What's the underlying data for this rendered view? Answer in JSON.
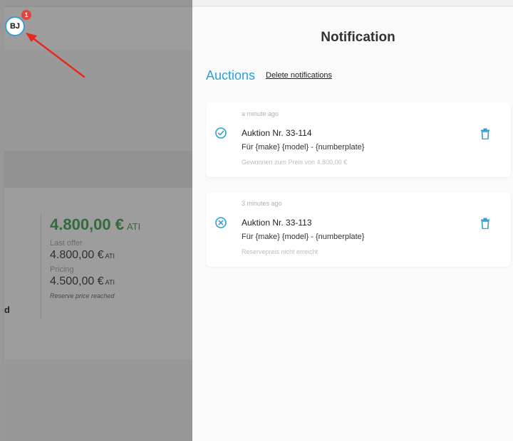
{
  "header": {
    "avatar_initials": "BJ",
    "notification_count": "1"
  },
  "background": {
    "main_price": "4.800,00 €",
    "main_price_tax": "ATI",
    "last_offer_label": "Last offer",
    "last_offer_price": "4.800,00 €",
    "last_offer_tax": "ATI",
    "pricing_label": "Pricing",
    "pricing_price": "4.500,00 €",
    "pricing_tax": "ATI",
    "reserve_note": "Reserve price reached",
    "cut_text": "d"
  },
  "panel": {
    "title": "Notification",
    "section_title": "Auctions",
    "delete_label": "Delete notifications",
    "notifications": [
      {
        "time": "a minute ago",
        "title": "Auktion Nr. 33-114",
        "subtitle": "Für {make} {model} - {numberplate}",
        "status": "Gewonnen zum Preis von 4.800,00 €",
        "icon": "check-circle-icon"
      },
      {
        "time": "3 minutes ago",
        "title": "Auktion Nr. 33-113",
        "subtitle": "Für {make} {model} - {numberplate}",
        "status": "Reservepreis nicht erreicht",
        "icon": "x-circle-icon"
      }
    ]
  },
  "colors": {
    "accent": "#2f9fd0",
    "price_green": "#2e9b3c",
    "badge_red": "#e0443b",
    "arrow_red": "#e8281e"
  }
}
